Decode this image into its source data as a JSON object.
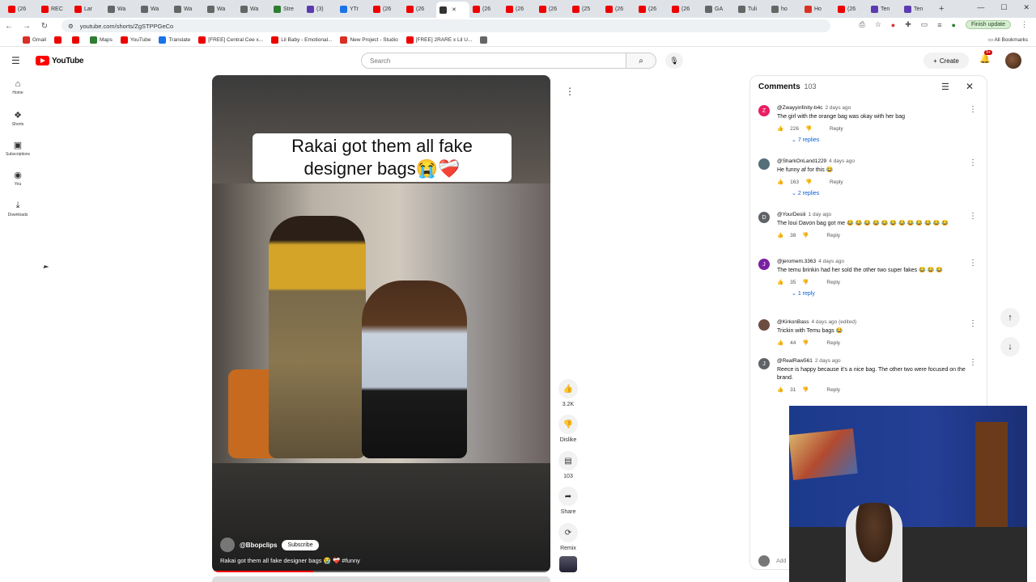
{
  "browser": {
    "tabs": [
      {
        "label": "(26",
        "fav": "yt"
      },
      {
        "label": "REC",
        "fav": "yt"
      },
      {
        "label": "Lar",
        "fav": "yt"
      },
      {
        "label": "Wa",
        "fav": "gray"
      },
      {
        "label": "Wa",
        "fav": "gray"
      },
      {
        "label": "Wa",
        "fav": "gray"
      },
      {
        "label": "Wa",
        "fav": "gray"
      },
      {
        "label": "Wa",
        "fav": "gray"
      },
      {
        "label": "Stre",
        "fav": "green"
      },
      {
        "label": "(3)",
        "fav": "purple"
      },
      {
        "label": "YTr",
        "fav": "blue"
      },
      {
        "label": "(26",
        "fav": "yt"
      },
      {
        "label": "(26",
        "fav": "yt"
      },
      {
        "label": "",
        "fav": "audio",
        "active": true
      },
      {
        "label": "(26",
        "fav": "yt"
      },
      {
        "label": "(26",
        "fav": "yt"
      },
      {
        "label": "(26",
        "fav": "yt"
      },
      {
        "label": "(25",
        "fav": "yt"
      },
      {
        "label": "(26",
        "fav": "yt"
      },
      {
        "label": "(26",
        "fav": "yt"
      },
      {
        "label": "(26",
        "fav": "yt"
      },
      {
        "label": "GA",
        "fav": "gray"
      },
      {
        "label": "Tuli",
        "fav": "gray"
      },
      {
        "label": "ho",
        "fav": "gray"
      },
      {
        "label": "Ho",
        "fav": "red"
      },
      {
        "label": "(26",
        "fav": "yt"
      },
      {
        "label": "Ten",
        "fav": "purple"
      },
      {
        "label": "Ten",
        "fav": "purple"
      }
    ],
    "new_tab": "+",
    "url": "youtube.com/shorts/ZgSTPPGeCo",
    "finish_update": "Finish update",
    "bookmarks": [
      {
        "label": "Gmail",
        "fav": "red"
      },
      {
        "label": "",
        "fav": "yt"
      },
      {
        "label": "",
        "fav": "yt"
      },
      {
        "label": "Maps",
        "fav": "green"
      },
      {
        "label": "YouTube",
        "fav": "yt"
      },
      {
        "label": "Translate",
        "fav": "blue"
      },
      {
        "label": "[FREE] Central Cee x...",
        "fav": "yt"
      },
      {
        "label": "Lil Baby - Emotional...",
        "fav": "yt"
      },
      {
        "label": "New Project - Studio",
        "fav": "red"
      },
      {
        "label": "[FREE] 2RARE x Lil U...",
        "fav": "yt"
      },
      {
        "label": "",
        "fav": "gray"
      }
    ],
    "all_bookmarks": "All Bookmarks"
  },
  "youtube": {
    "logo_text": "YouTube",
    "search_placeholder": "Search",
    "create_label": "Create",
    "notif_badge": "9+",
    "sidebar": [
      {
        "label": "Home",
        "icon": "home-icon",
        "glyph": "⌂"
      },
      {
        "label": "Shorts",
        "icon": "shorts-icon",
        "glyph": "❖"
      },
      {
        "label": "Subscriptions",
        "icon": "subscriptions-icon",
        "glyph": "▣"
      },
      {
        "label": "You",
        "icon": "you-icon",
        "glyph": "◉"
      },
      {
        "label": "Downloads",
        "icon": "downloads-icon",
        "glyph": "⤓"
      }
    ]
  },
  "short": {
    "caption": "Rakai got them all fake designer bags😭❤️‍🩹",
    "channel": "@Bbopclips",
    "subscribe": "Subscribe",
    "title": "Rakai got them all fake designer bags 😭 ❤️‍🩹 #funny",
    "actions": {
      "likes": "3.2K",
      "dislike": "Dislike",
      "comments": "103",
      "share": "Share",
      "remix": "Remix"
    }
  },
  "comments_panel": {
    "title": "Comments",
    "count": "103",
    "add_placeholder": "Add",
    "reply_label": "Reply",
    "items": [
      {
        "author": "@Zwayyinfinity-b4c",
        "time": "2 days ago",
        "text": "The girl with the orange bag was okay with her bag",
        "likes": "226",
        "replies": "7 replies",
        "avatar": "Z",
        "color": "#e91e63"
      },
      {
        "author": "@SharkOnLand1229",
        "time": "4 days ago",
        "text": "He funny af for this 😂",
        "likes": "163",
        "replies": "2 replies",
        "avatar": "",
        "color": "#546e7a"
      },
      {
        "author": "@YourDesiii",
        "time": "1 day ago",
        "text": "The loui Davon bag got me 😂 😂 😂 😂 😂 😂 😂 😂 😂 😂 😂 😂",
        "likes": "38",
        "replies": "",
        "avatar": "D",
        "color": "#5f6368"
      },
      {
        "author": "@jeromem.3363",
        "time": "4 days ago",
        "text": "The temu brinkin had her sold the other two super fakes 😂 😂 😂",
        "likes": "35",
        "replies": "1 reply",
        "avatar": "J",
        "color": "#7b1fa2"
      },
      {
        "author": "@KirkonBass",
        "time": "4 days ago (edited)",
        "text": "Trickin with Temu bags 😂",
        "likes": "44",
        "replies": "",
        "avatar": "",
        "color": "#6d4c41"
      },
      {
        "author": "@RealRaw561",
        "time": "2 days ago",
        "text": "Reece is happy because it's a nice bag. The other two were focused on the brand.",
        "likes": "31",
        "replies": "",
        "avatar": "J",
        "color": "#5f6368"
      }
    ]
  }
}
